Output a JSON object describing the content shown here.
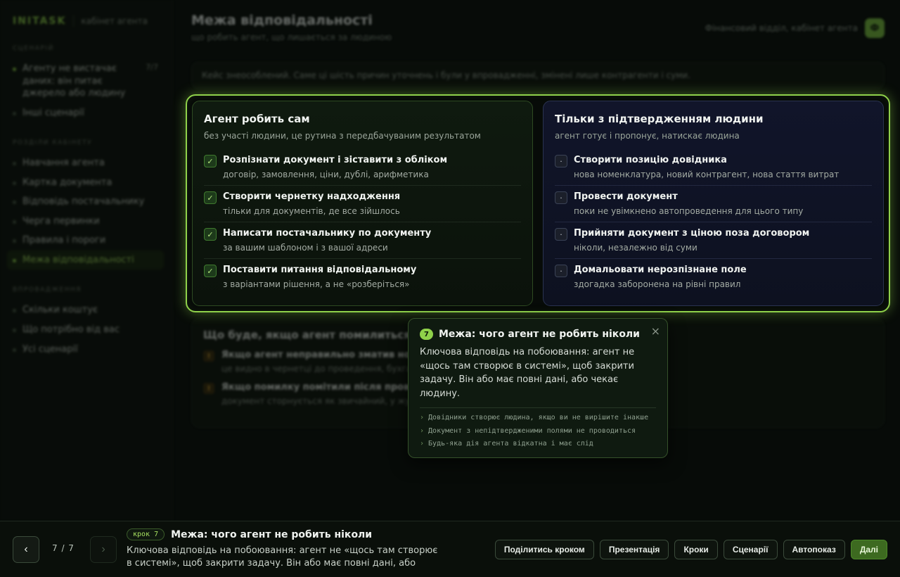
{
  "brand": {
    "logo": "INITASK",
    "subtitle": "кабінет агента"
  },
  "sidebar": {
    "groups": [
      {
        "title": "СЦЕНАРІЙ",
        "items": [
          {
            "label": "Агенту не вистачає даних: він питає джерело або людину",
            "count": "7/7"
          },
          {
            "label": "Інші сценарії"
          }
        ]
      },
      {
        "title": "РОЗДІЛИ КАБІНЕТУ",
        "items": [
          {
            "label": "Навчання агента"
          },
          {
            "label": "Картка документа"
          },
          {
            "label": "Відповідь постачальнику"
          },
          {
            "label": "Черга первинки"
          },
          {
            "label": "Правила і пороги"
          },
          {
            "label": "Межа відповідальності"
          }
        ]
      },
      {
        "title": "ВПРОВАДЖЕННЯ",
        "items": [
          {
            "label": "Скільки коштує"
          },
          {
            "label": "Що потрібно від вас"
          },
          {
            "label": "Усі сценарії"
          }
        ]
      }
    ]
  },
  "header": {
    "title": "Межа відповідальності",
    "subtitle": "що робить агент, що лишається за людиною",
    "context": "Фінансовий відділ, кабінет агента",
    "avatar": "Ф"
  },
  "note": "Кейс знеособлений. Саме ці шість причин уточнень і були у впровадженні, змінені лише контрагенти і суми.",
  "left_panel": {
    "title": "Агент робить сам",
    "subtitle": "без участі людини, це рутина з передбачуваним результатом",
    "mark": "✓",
    "items": [
      {
        "title": "Розпізнати документ і зіставити з обліком",
        "desc": "договір, замовлення, ціни, дублі, арифметика"
      },
      {
        "title": "Створити чернетку надходження",
        "desc": "тільки для документів, де все зійшлось"
      },
      {
        "title": "Написати постачальнику по документу",
        "desc": "за вашим шаблоном і з вашої адреси"
      },
      {
        "title": "Поставити питання відповідальному",
        "desc": "з варіантами рішення, а не «розберіться»"
      }
    ]
  },
  "right_panel": {
    "title": "Тільки з підтвердженням людини",
    "subtitle": "агент готує і пропонує, натискає людина",
    "mark": "·",
    "items": [
      {
        "title": "Створити позицію довідника",
        "desc": "нова номенклатура, новий контрагент, нова стаття витрат"
      },
      {
        "title": "Провести документ",
        "desc": "поки не увімкнено автопроведення для цього типу"
      },
      {
        "title": "Прийняти документ з ціною поза договором",
        "desc": "ніколи, незалежно від суми"
      },
      {
        "title": "Домальовати нерозпізнане поле",
        "desc": "здогадка заборонена на рівні правил"
      }
    ]
  },
  "errors_card": {
    "title": "Що буде, якщо агент помилиться",
    "items": [
      {
        "badge": "!",
        "title": "Якщо агент неправильно зматив нові",
        "desc": "це видно в чернетці до проведення, бухгалтер"
      },
      {
        "badge": "!",
        "title": "Якщо помилку помітили після прове",
        "desc": "документ сторнується як звичайний, у журн"
      }
    ]
  },
  "tooltip": {
    "number": "7",
    "title": "Межа: чого агент не робить ніколи",
    "close": "×",
    "body": "Ключова відповідь на побоювання: агент не «щось там створює в системі», щоб закрити задачу. Він або має повні дані, або чекає людину.",
    "bullets": [
      "Довідники створює людина, якщо ви не вирішите інакше",
      "Документ з непідтвердженими полями не проводиться",
      "Будь-яка дія агента відкатна і має слід"
    ]
  },
  "bottombar": {
    "prev": "‹",
    "next": "›",
    "counter": "7 / 7",
    "step_chip": "крок 7",
    "step_title": "Межа: чого агент не робить ніколи",
    "step_desc": "Ключова відповідь на побоювання: агент не «щось там створює в системі», щоб закрити задачу. Він або має повні дані, або чекає…",
    "buttons": {
      "share": "Поділитись кроком",
      "presentation": "Презентація",
      "steps": "Кроки",
      "scenarios": "Сценарії",
      "autoplay": "Автопоказ",
      "next": "Далі"
    }
  },
  "colors": {
    "accent": "#8fd14a",
    "background": "#070b08"
  }
}
